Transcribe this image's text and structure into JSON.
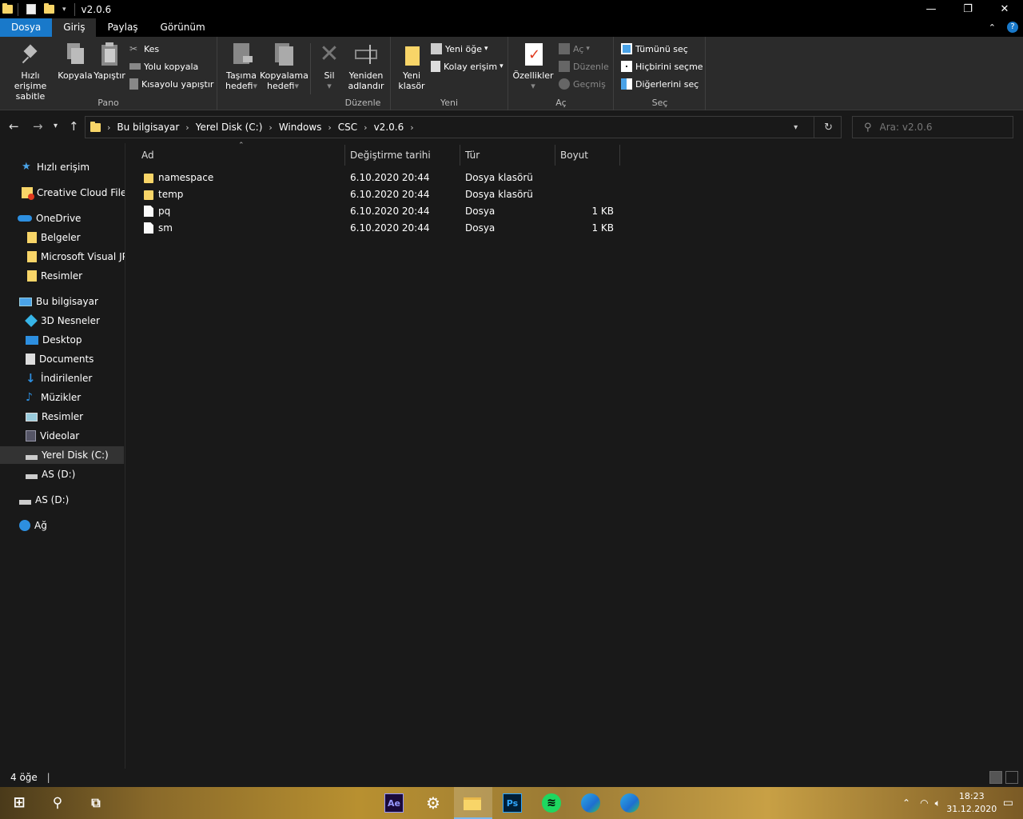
{
  "window": {
    "title": "v2.0.6"
  },
  "ribbon_tabs": [
    "Dosya",
    "Giriş",
    "Paylaş",
    "Görünüm"
  ],
  "ribbon": {
    "pano": {
      "label": "Pano",
      "pin": "Hızlı erişime sabitle",
      "copy": "Kopyala",
      "paste": "Yapıştır",
      "cut": "Kes",
      "copy_path": "Yolu kopyala",
      "paste_shortcut": "Kısayolu yapıştır"
    },
    "duzenle": {
      "label": "Düzenle",
      "move_to": "Taşıma hedefi",
      "copy_to": "Kopyalama hedefi",
      "delete": "Sil",
      "rename": "Yeniden adlandır"
    },
    "yeni": {
      "label": "Yeni",
      "new_folder": "Yeni klasör",
      "new_item": "Yeni öğe",
      "easy_access": "Kolay erişim"
    },
    "ac": {
      "label": "Aç",
      "properties": "Özellikler",
      "open": "Aç",
      "edit": "Düzenle",
      "history": "Geçmiş"
    },
    "sec": {
      "label": "Seç",
      "select_all": "Tümünü seç",
      "select_none": "Hiçbirini seçme",
      "invert": "Diğerlerini seç"
    }
  },
  "breadcrumb": [
    "Bu bilgisayar",
    "Yerel Disk (C:)",
    "Windows",
    "CSC",
    "v2.0.6"
  ],
  "search": {
    "placeholder": "Ara: v2.0.6"
  },
  "sidebar": [
    {
      "label": "Hızlı erişim",
      "icon": "star-icon"
    },
    {
      "label": "Creative Cloud Files",
      "icon": "creative-cloud-folder-icon"
    },
    {
      "label": "OneDrive",
      "icon": "cloud-icon"
    },
    {
      "label": "Belgeler",
      "icon": "folder-icon"
    },
    {
      "label": "Microsoft Visual JPP",
      "icon": "folder-icon"
    },
    {
      "label": "Resimler",
      "icon": "folder-icon"
    },
    {
      "label": "Bu bilgisayar",
      "icon": "computer-icon"
    },
    {
      "label": "3D Nesneler",
      "icon": "cube-icon"
    },
    {
      "label": "Desktop",
      "icon": "desktop-icon"
    },
    {
      "label": "Documents",
      "icon": "document-icon"
    },
    {
      "label": "İndirilenler",
      "icon": "download-icon"
    },
    {
      "label": "Müzikler",
      "icon": "music-icon"
    },
    {
      "label": "Resimler",
      "icon": "pictures-icon"
    },
    {
      "label": "Videolar",
      "icon": "video-icon"
    },
    {
      "label": "Yerel Disk (C:)",
      "icon": "drive-icon"
    },
    {
      "label": "AS (D:)",
      "icon": "drive-icon"
    },
    {
      "label": "AS (D:)",
      "icon": "drive-icon"
    },
    {
      "label": "Ağ",
      "icon": "network-icon"
    }
  ],
  "columns": [
    "Ad",
    "Değiştirme tarihi",
    "Tür",
    "Boyut"
  ],
  "files": [
    {
      "name": "namespace",
      "date": "6.10.2020 20:44",
      "type": "Dosya klasörü",
      "size": "",
      "kind": "folder"
    },
    {
      "name": "temp",
      "date": "6.10.2020 20:44",
      "type": "Dosya klasörü",
      "size": "",
      "kind": "folder"
    },
    {
      "name": "pq",
      "date": "6.10.2020 20:44",
      "type": "Dosya",
      "size": "1 KB",
      "kind": "file"
    },
    {
      "name": "sm",
      "date": "6.10.2020 20:44",
      "type": "Dosya",
      "size": "1 KB",
      "kind": "file"
    }
  ],
  "status": {
    "count": "4 öğe"
  },
  "taskbar": {
    "apps": [
      {
        "label": "Ae",
        "icon": "after-effects-icon",
        "color": "#9999ff",
        "bg": "#1a0a3a"
      },
      {
        "label": "",
        "icon": "settings-gear-icon",
        "color": "#ffffff",
        "bg": "transparent"
      },
      {
        "label": "",
        "icon": "file-explorer-icon",
        "color": "#f8d568",
        "bg": "transparent"
      },
      {
        "label": "Ps",
        "icon": "photoshop-icon",
        "color": "#31a8ff",
        "bg": "#001e36"
      },
      {
        "label": "",
        "icon": "spotify-icon",
        "color": "#1ed760",
        "bg": "transparent"
      },
      {
        "label": "",
        "icon": "edge-icon",
        "color": "#2fa9e6",
        "bg": "transparent"
      },
      {
        "label": "",
        "icon": "edge-icon",
        "color": "#2fa9e6",
        "bg": "transparent"
      }
    ],
    "time": "18:23",
    "date": "31.12.2020"
  }
}
